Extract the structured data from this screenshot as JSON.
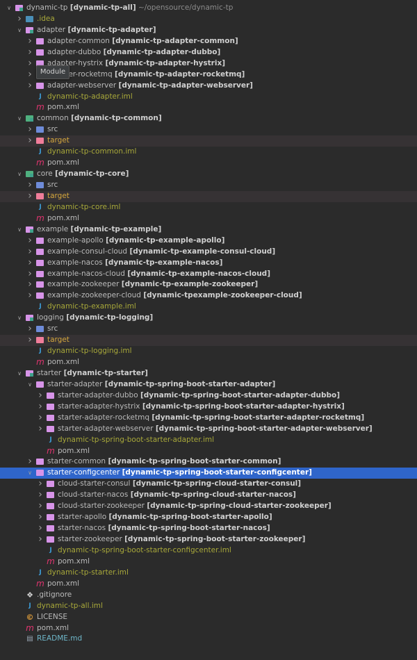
{
  "tooltip": "Module",
  "rows": [
    {
      "level": 0,
      "arrow": "down",
      "icon": "module",
      "label": "dynamic-tp",
      "module": "[dynamic-tp-all]",
      "extra": "~/opensource/dynamic-tp"
    },
    {
      "level": 1,
      "arrow": "right",
      "icon": "idea",
      "label": ".idea",
      "color": "olive"
    },
    {
      "level": 1,
      "arrow": "down",
      "icon": "module",
      "label": "adapter",
      "module": "[dynamic-tp-adapter]"
    },
    {
      "level": 2,
      "arrow": "right",
      "icon": "folder",
      "label": "adapter-common",
      "module": "[dynamic-tp-adapter-common]"
    },
    {
      "level": 2,
      "arrow": "right",
      "icon": "folder",
      "label": "adapter-dubbo",
      "module": "[dynamic-tp-adapter-dubbo]"
    },
    {
      "level": 2,
      "arrow": "right",
      "icon": "folder",
      "label": "adapter-hystrix",
      "module": "[dynamic-tp-adapter-hystrix]"
    },
    {
      "level": 2,
      "arrow": "right",
      "icon": "folder",
      "label": "adapter-rocketmq",
      "module": "[dynamic-tp-adapter-rocketmq]"
    },
    {
      "level": 2,
      "arrow": "right",
      "icon": "folder",
      "label": "adapter-webserver",
      "module": "[dynamic-tp-adapter-webserver]"
    },
    {
      "level": 2,
      "arrow": "",
      "icon": "iml",
      "label": "dynamic-tp-adapter.iml",
      "color": "olive"
    },
    {
      "level": 2,
      "arrow": "",
      "icon": "pom",
      "label": "pom.xml"
    },
    {
      "level": 1,
      "arrow": "down",
      "icon": "module-green",
      "label": "common",
      "module": "[dynamic-tp-common]"
    },
    {
      "level": 2,
      "arrow": "right",
      "icon": "src",
      "label": "src"
    },
    {
      "level": 2,
      "arrow": "right",
      "icon": "target",
      "label": "target",
      "color": "target"
    },
    {
      "level": 2,
      "arrow": "",
      "icon": "iml",
      "label": "dynamic-tp-common.iml",
      "color": "olive"
    },
    {
      "level": 2,
      "arrow": "",
      "icon": "pom",
      "label": "pom.xml"
    },
    {
      "level": 1,
      "arrow": "down",
      "icon": "module-green",
      "label": "core",
      "module": "[dynamic-tp-core]"
    },
    {
      "level": 2,
      "arrow": "right",
      "icon": "src",
      "label": "src"
    },
    {
      "level": 2,
      "arrow": "right",
      "icon": "target",
      "label": "target",
      "color": "target"
    },
    {
      "level": 2,
      "arrow": "",
      "icon": "iml",
      "label": "dynamic-tp-core.iml",
      "color": "olive"
    },
    {
      "level": 2,
      "arrow": "",
      "icon": "pom",
      "label": "pom.xml"
    },
    {
      "level": 1,
      "arrow": "down",
      "icon": "module",
      "label": "example",
      "module": "[dynamic-tp-example]"
    },
    {
      "level": 2,
      "arrow": "right",
      "icon": "folder",
      "label": "example-apollo",
      "module": "[dynamic-tp-example-apollo]"
    },
    {
      "level": 2,
      "arrow": "right",
      "icon": "folder",
      "label": "example-consul-cloud",
      "module": "[dynamic-tp-example-consul-cloud]"
    },
    {
      "level": 2,
      "arrow": "right",
      "icon": "folder",
      "label": "example-nacos",
      "module": "[dynamic-tp-example-nacos]"
    },
    {
      "level": 2,
      "arrow": "right",
      "icon": "folder",
      "label": "example-nacos-cloud",
      "module": "[dynamic-tp-example-nacos-cloud]"
    },
    {
      "level": 2,
      "arrow": "right",
      "icon": "folder",
      "label": "example-zookeeper",
      "module": "[dynamic-tp-example-zookeeper]"
    },
    {
      "level": 2,
      "arrow": "right",
      "icon": "folder",
      "label": "example-zookeeper-cloud",
      "module": "[dynamic-tpexample-zookeeper-cloud]"
    },
    {
      "level": 2,
      "arrow": "",
      "icon": "iml",
      "label": "dynamic-tp-example.iml",
      "color": "olive"
    },
    {
      "level": 1,
      "arrow": "down",
      "icon": "module",
      "label": "logging",
      "module": "[dynamic-tp-logging]"
    },
    {
      "level": 2,
      "arrow": "right",
      "icon": "src",
      "label": "src"
    },
    {
      "level": 2,
      "arrow": "right",
      "icon": "target",
      "label": "target",
      "color": "target"
    },
    {
      "level": 2,
      "arrow": "",
      "icon": "iml",
      "label": "dynamic-tp-logging.iml",
      "color": "olive"
    },
    {
      "level": 2,
      "arrow": "",
      "icon": "pom",
      "label": "pom.xml"
    },
    {
      "level": 1,
      "arrow": "down",
      "icon": "module",
      "label": "starter",
      "module": "[dynamic-tp-starter]"
    },
    {
      "level": 2,
      "arrow": "down",
      "icon": "folder",
      "label": "starter-adapter",
      "module": "[dynamic-tp-spring-boot-starter-adapter]"
    },
    {
      "level": 3,
      "arrow": "right",
      "icon": "folder",
      "label": "starter-adapter-dubbo",
      "module": "[dynamic-tp-spring-boot-starter-adapter-dubbo]"
    },
    {
      "level": 3,
      "arrow": "right",
      "icon": "folder",
      "label": "starter-adapter-hystrix",
      "module": "[dynamic-tp-spring-boot-starter-adapter-hystrix]"
    },
    {
      "level": 3,
      "arrow": "right",
      "icon": "folder",
      "label": "starter-adapter-rocketmq",
      "module": "[dynamic-tp-spring-boot-starter-adapter-rocketmq]"
    },
    {
      "level": 3,
      "arrow": "right",
      "icon": "folder",
      "label": "starter-adapter-webserver",
      "module": "[dynamic-tp-spring-boot-starter-adapter-webserver]"
    },
    {
      "level": 3,
      "arrow": "",
      "icon": "iml",
      "label": "dynamic-tp-spring-boot-starter-adapter.iml",
      "color": "olive"
    },
    {
      "level": 3,
      "arrow": "",
      "icon": "pom",
      "label": "pom.xml"
    },
    {
      "level": 2,
      "arrow": "right",
      "icon": "folder",
      "label": "starter-common",
      "module": "[dynamic-tp-spring-boot-starter-common]"
    },
    {
      "level": 2,
      "arrow": "down",
      "icon": "folder",
      "label": "starter-configcenter",
      "module": "[dynamic-tp-spring-boot-starter-configcenter]",
      "selected": true
    },
    {
      "level": 3,
      "arrow": "right",
      "icon": "folder",
      "label": "cloud-starter-consul",
      "module": "[dynamic-tp-spring-cloud-starter-consul]"
    },
    {
      "level": 3,
      "arrow": "right",
      "icon": "folder",
      "label": "cloud-starter-nacos",
      "module": "[dynamic-tp-spring-cloud-starter-nacos]"
    },
    {
      "level": 3,
      "arrow": "right",
      "icon": "folder",
      "label": "cloud-starter-zookeeper",
      "module": "[dynamic-tp-spring-cloud-starter-zookeeper]"
    },
    {
      "level": 3,
      "arrow": "right",
      "icon": "folder",
      "label": "starter-apollo",
      "module": "[dynamic-tp-spring-boot-starter-apollo]"
    },
    {
      "level": 3,
      "arrow": "right",
      "icon": "folder",
      "label": "starter-nacos",
      "module": "[dynamic-tp-spring-boot-starter-nacos]"
    },
    {
      "level": 3,
      "arrow": "right",
      "icon": "folder",
      "label": "starter-zookeeper",
      "module": "[dynamic-tp-spring-boot-starter-zookeeper]"
    },
    {
      "level": 3,
      "arrow": "",
      "icon": "iml",
      "label": "dynamic-tp-spring-boot-starter-configcenter.iml",
      "color": "olive"
    },
    {
      "level": 3,
      "arrow": "",
      "icon": "pom",
      "label": "pom.xml"
    },
    {
      "level": 2,
      "arrow": "",
      "icon": "iml",
      "label": "dynamic-tp-starter.iml",
      "color": "olive"
    },
    {
      "level": 2,
      "arrow": "",
      "icon": "pom",
      "label": "pom.xml"
    },
    {
      "level": 1,
      "arrow": "",
      "icon": "git",
      "label": ".gitignore"
    },
    {
      "level": 1,
      "arrow": "",
      "icon": "iml",
      "label": "dynamic-tp-all.iml",
      "color": "olive"
    },
    {
      "level": 1,
      "arrow": "",
      "icon": "lic",
      "label": "LICENSE"
    },
    {
      "level": 1,
      "arrow": "",
      "icon": "pom",
      "label": "pom.xml"
    },
    {
      "level": 1,
      "arrow": "",
      "icon": "md",
      "label": "README.md",
      "color": "teal"
    }
  ]
}
